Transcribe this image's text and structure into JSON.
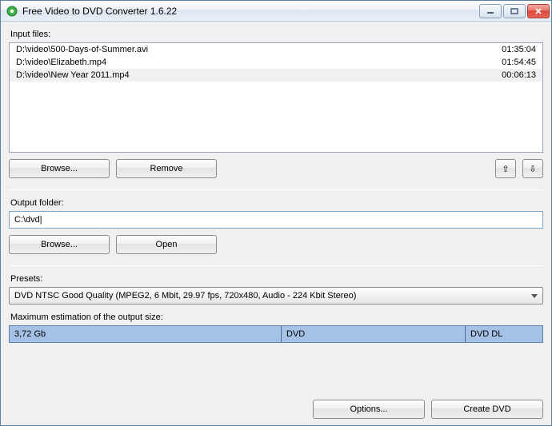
{
  "titlebar": {
    "title": "Free Video to DVD Converter 1.6.22"
  },
  "labels": {
    "input_files": "Input files:",
    "output_folder": "Output folder:",
    "presets": "Presets:",
    "max_estimate": "Maximum estimation of the output size:"
  },
  "input_list": [
    {
      "path": "D:\\video\\500-Days-of-Summer.avi",
      "duration": "01:35:04",
      "selected": false
    },
    {
      "path": "D:\\video\\Elizabeth.mp4",
      "duration": "01:54:45",
      "selected": false
    },
    {
      "path": "D:\\video\\New Year 2011.mp4",
      "duration": "00:06:13",
      "selected": true
    }
  ],
  "buttons": {
    "browse": "Browse...",
    "remove": "Remove",
    "open": "Open",
    "options": "Options...",
    "create_dvd": "Create DVD"
  },
  "output": {
    "value": "C:\\dvd|"
  },
  "preset": {
    "selected": "DVD NTSC Good Quality (MPEG2, 6 Mbit, 29.97 fps, 720x480, Audio - 224 Kbit Stereo)"
  },
  "size_bar": {
    "estimate": "3,72 Gb",
    "mark1": "DVD",
    "mark2": "DVD DL"
  },
  "icons": {
    "up": "⇧",
    "down": "⇩",
    "min": "—",
    "max": "▢",
    "close": "✕"
  }
}
